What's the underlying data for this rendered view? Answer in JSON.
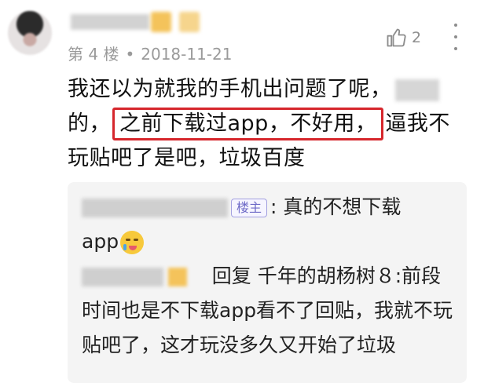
{
  "comment": {
    "floor_label": "第 4 楼",
    "separator": "•",
    "date": "2018-11-21",
    "likes": "2",
    "text_line1": "我还以为就我的手机出问题了呢，",
    "text_line2_start": "的，",
    "highlighted_text": "之前下载过app，不好用，",
    "text_line2_end": "逼我不",
    "text_line3": "玩贴吧了是吧，垃圾百度"
  },
  "replies": [
    {
      "badge": "楼主",
      "text": ": 真的不想下载",
      "text_cont": "app"
    },
    {
      "reply_prefix": "回复 千年的胡杨树８:",
      "text": "前段时间也是不下载app看不了回贴，我就不玩贴吧了，这才玩没多久又开始了垃圾"
    }
  ],
  "colors": {
    "highlight_border": "#d6262c",
    "meta_text": "#9a9a9a",
    "louzhu_badge": "#6f6bc7",
    "reply_bg": "#f4f4f4"
  }
}
